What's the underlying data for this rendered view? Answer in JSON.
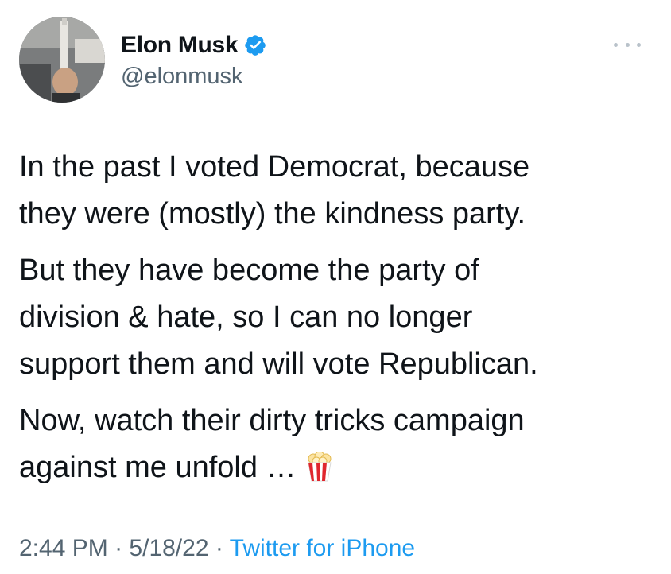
{
  "author": {
    "display_name": "Elon Musk",
    "handle": "@elonmusk",
    "verified": true
  },
  "tweet": {
    "paragraphs": [
      "In the past I voted Democrat, because\nthey were (mostly) the kindness party.",
      "But they have become the party of\ndivision & hate, so I can no longer\nsupport them and will vote Republican.",
      "Now, watch their dirty tricks campaign\nagainst me unfold …"
    ],
    "trailing_emoji": "popcorn-icon"
  },
  "meta": {
    "time": "2:44 PM",
    "separator": "·",
    "date": "5/18/22",
    "source": "Twitter for iPhone"
  },
  "colors": {
    "text": "#0f1419",
    "secondary": "#536471",
    "accent": "#1d9bf0"
  }
}
